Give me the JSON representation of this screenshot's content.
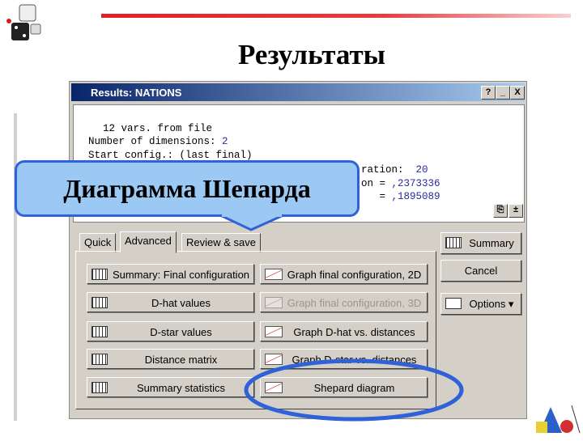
{
  "slide": {
    "title": "Результаты",
    "callout": "Диаграмма Шепарда"
  },
  "window": {
    "title": "Results: NATIONS",
    "help": "?",
    "minimize": "_",
    "close": "X"
  },
  "output": {
    "lines": [
      "12 vars. from file",
      "Number of dimensions: ",
      "Start config.: (last final)",
      "ration:  ",
      "on = ",
      "   = "
    ],
    "dims": "2",
    "iter": "20",
    "v1": ",2373336",
    "v2": ",1895089"
  },
  "tabs": [
    "Quick",
    "Advanced",
    "Review & save"
  ],
  "buttons": {
    "col1": [
      "Summary: Final configuration",
      "D-hat values",
      "D-star values",
      "Distance matrix",
      "Summary statistics"
    ],
    "col2": [
      "Graph final configuration, 2D",
      "Graph final configuration, 3D",
      "Graph D-hat vs. distances",
      "Graph D-star vs. distances",
      "Shepard diagram"
    ]
  },
  "side": {
    "summary": "Summary",
    "cancel": "Cancel",
    "options": "Options ▾"
  },
  "colors": {
    "accent": "#2f62d6",
    "callout_fill": "#9cc8f4",
    "titlebar": "#0a246a"
  }
}
